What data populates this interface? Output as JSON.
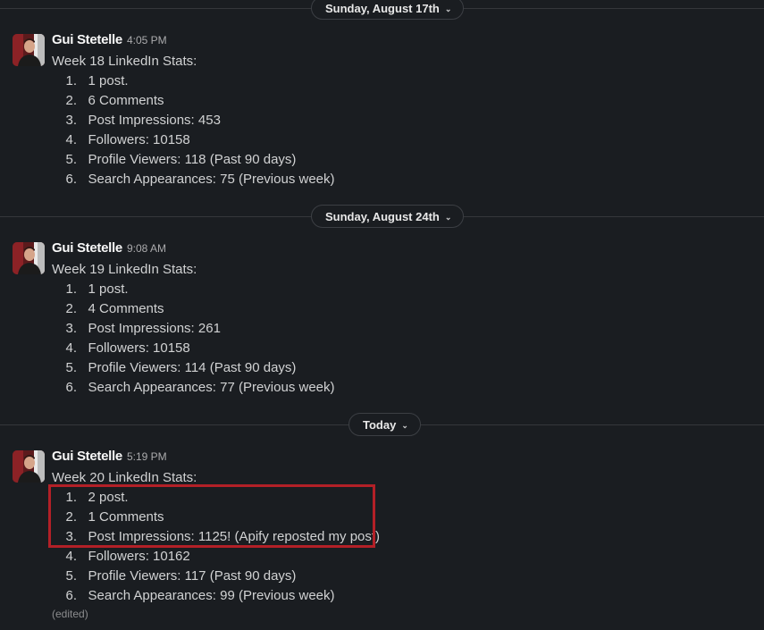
{
  "dividers": [
    {
      "date_label": "Sunday, August 17th"
    },
    {
      "date_label": "Sunday, August 24th"
    },
    {
      "date_label": "Today"
    }
  ],
  "messages": [
    {
      "author": "Gui Stetelle",
      "time": "4:05 PM",
      "heading": "Week 18 LinkedIn Stats:",
      "items": [
        {
          "num": "1.",
          "text": "1 post."
        },
        {
          "num": "2.",
          "text": "6 Comments"
        },
        {
          "num": "3.",
          "text": "Post Impressions: 453"
        },
        {
          "num": "4.",
          "text": "Followers: 10158"
        },
        {
          "num": "5.",
          "text": "Profile Viewers: 118 (Past 90 days)"
        },
        {
          "num": "6.",
          "text": "Search Appearances: 75 (Previous week)"
        }
      ]
    },
    {
      "author": "Gui Stetelle",
      "time": "9:08 AM",
      "heading": "Week 19 LinkedIn Stats:",
      "items": [
        {
          "num": "1.",
          "text": "1 post."
        },
        {
          "num": "2.",
          "text": "4 Comments"
        },
        {
          "num": "3.",
          "text": "Post Impressions: 261"
        },
        {
          "num": "4.",
          "text": "Followers: 10158"
        },
        {
          "num": "5.",
          "text": "Profile Viewers: 114 (Past 90 days)"
        },
        {
          "num": "6.",
          "text": "Search Appearances: 77 (Previous week)"
        }
      ]
    },
    {
      "author": "Gui Stetelle",
      "time": "5:19 PM",
      "heading": "Week 20 LinkedIn Stats:",
      "items": [
        {
          "num": "1.",
          "text": "2 post."
        },
        {
          "num": "2.",
          "text": "1 Comments"
        },
        {
          "num": "3.",
          "text": "Post Impressions: 1125! (Apify reposted my post)"
        },
        {
          "num": "4.",
          "text": "Followers: 10162"
        },
        {
          "num": "5.",
          "text": "Profile Viewers: 117 (Past 90 days)"
        },
        {
          "num": "6.",
          "text": "Search Appearances: 99 (Previous week)"
        }
      ],
      "edited_label": "(edited)"
    }
  ],
  "icons": {
    "date_chevron": "chevron-down-icon",
    "avatar": "avatar"
  },
  "colors": {
    "background": "#1a1d21",
    "text": "#d1d2d3",
    "highlight_border": "#b32027"
  }
}
